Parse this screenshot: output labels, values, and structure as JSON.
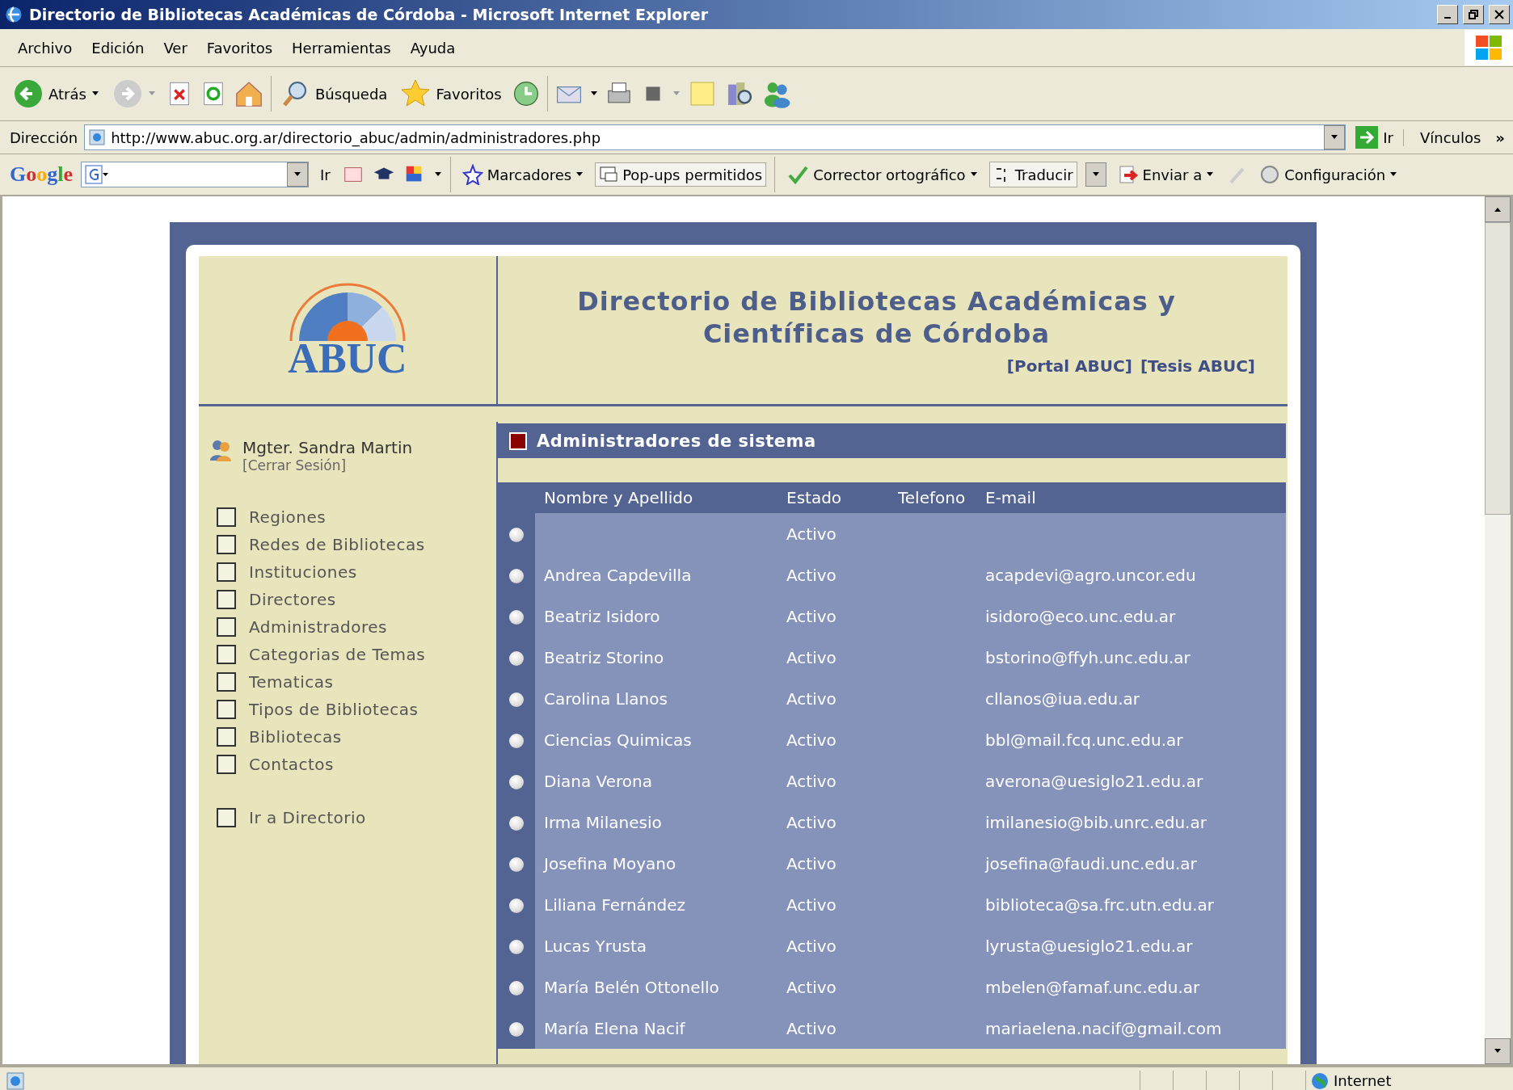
{
  "window": {
    "title": "Directorio de Bibliotecas Académicas de Córdoba - Microsoft Internet Explorer"
  },
  "menu_bar": [
    "Archivo",
    "Edición",
    "Ver",
    "Favoritos",
    "Herramientas",
    "Ayuda"
  ],
  "toolbar": {
    "back": "Atrás",
    "search": "Búsqueda",
    "favorites": "Favoritos"
  },
  "address_bar": {
    "label": "Dirección",
    "url": "http://www.abuc.org.ar/directorio_abuc/admin/administradores.php",
    "go": "Ir",
    "links": "Vínculos",
    "more": "»"
  },
  "google_bar": {
    "logo": "Google",
    "go": "Ir",
    "bookmarks": "Marcadores",
    "popups": "Pop-ups permitidos",
    "spell": "Corrector ortográfico",
    "translate": "Traducir",
    "send": "Enviar a",
    "settings": "Configuración"
  },
  "page": {
    "logo_text": "ABUC",
    "title_lines": [
      "Directorio de Bibliotecas Académicas y",
      "Científicas de Córdoba"
    ],
    "header_links": [
      "[Portal ABUC]",
      "[Tesis ABUC]"
    ],
    "user": {
      "name": "Mgter. Sandra Martin",
      "logout": "[Cerrar Sesión]"
    },
    "nav": [
      "Regiones",
      "Redes de Bibliotecas",
      "Instituciones",
      "Directores",
      "Administradores",
      "Categorias de Temas",
      "Tematicas",
      "Tipos de Bibliotecas",
      "Bibliotecas",
      "Contactos"
    ],
    "nav_extra": "Ir a Directorio",
    "section_title": "Administradores de sistema",
    "table": {
      "columns": [
        "Nombre y Apellido",
        "Estado",
        "Telefono",
        "E-mail"
      ],
      "rows": [
        {
          "name": "",
          "status": "Activo",
          "email": "",
          "selected": false
        },
        {
          "name": "Andrea Capdevilla",
          "status": "Activo",
          "email": "acapdevi@agro.uncor.edu",
          "selected": false
        },
        {
          "name": "Beatriz Isidoro",
          "status": "Activo",
          "email": "isidoro@eco.unc.edu.ar",
          "selected": false
        },
        {
          "name": "Beatriz Storino",
          "status": "Activo",
          "email": "bstorino@ffyh.unc.edu.ar",
          "selected": false
        },
        {
          "name": "Carolina Llanos",
          "status": "Activo",
          "email": "cllanos@iua.edu.ar",
          "selected": false
        },
        {
          "name": "Ciencias Quimicas",
          "status": "Activo",
          "email": "bbl@mail.fcq.unc.edu.ar",
          "selected": false
        },
        {
          "name": "Diana Verona",
          "status": "Activo",
          "email": "averona@uesiglo21.edu.ar",
          "selected": false
        },
        {
          "name": "Irma Milanesio",
          "status": "Activo",
          "email": "imilanesio@bib.unrc.edu.ar",
          "selected": false
        },
        {
          "name": "Josefina Moyano",
          "status": "Activo",
          "email": "josefina@faudi.unc.edu.ar",
          "selected": false
        },
        {
          "name": "Liliana Fernández",
          "status": "Activo",
          "email": "biblioteca@sa.frc.utn.edu.ar",
          "selected": false
        },
        {
          "name": "Lucas Yrusta",
          "status": "Activo",
          "email": "lyrusta@uesiglo21.edu.ar",
          "selected": false
        },
        {
          "name": "María Belén Ottonello",
          "status": "Activo",
          "email": "mbelen@famaf.unc.edu.ar",
          "selected": false
        },
        {
          "name": "María Elena Nacif",
          "status": "Activo",
          "email": "mariaelena.nacif@gmail.com",
          "selected": false
        }
      ]
    }
  },
  "status_bar": {
    "zone": "Internet"
  }
}
